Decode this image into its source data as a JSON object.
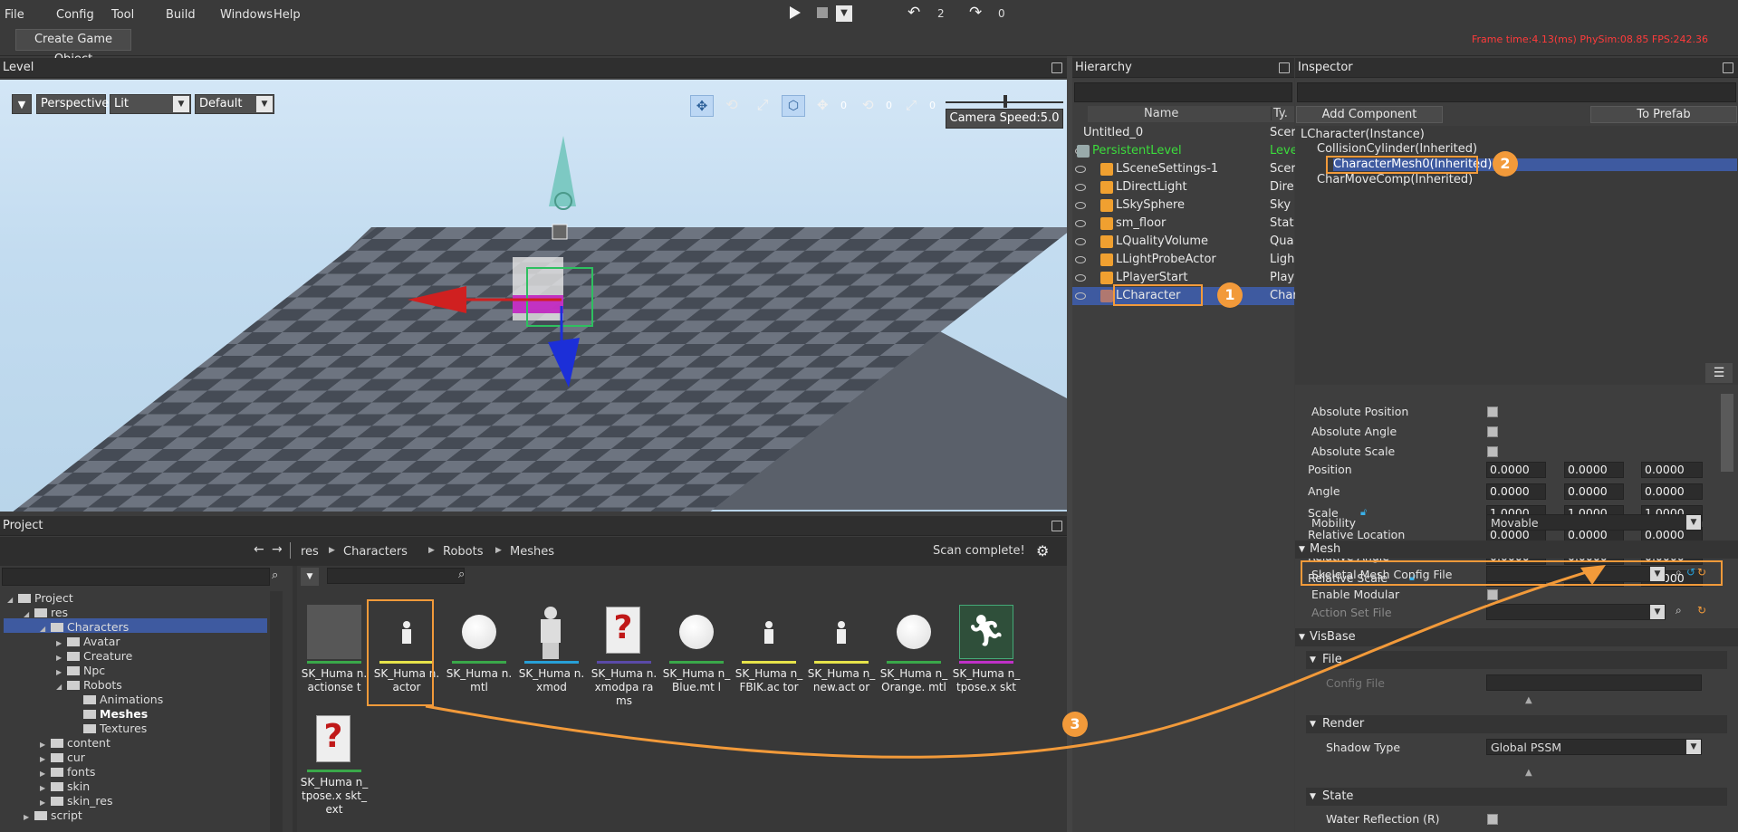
{
  "menu": {
    "items": [
      "File",
      "Config",
      "Tool",
      "Build",
      "Windows",
      "Help"
    ]
  },
  "playbar": {
    "undo_count": "2",
    "redo_count": "0"
  },
  "toolbar": {
    "create_game_object": "Create Game Object"
  },
  "stats": {
    "text": "Frame time:4.13(ms)  PhySim:08.85  FPS:242.36",
    "color": "#ff3b3b"
  },
  "level": {
    "title": "Level",
    "view_mode": "Perspective",
    "lighting": "Lit",
    "preset": "Default",
    "gizmo_counts": [
      "0",
      "0",
      "0"
    ],
    "camera_speed": "Camera Speed:5.0"
  },
  "hierarchy": {
    "title": "Hierarchy",
    "col_name": "Name",
    "col_type": "Ty.",
    "rows": [
      {
        "name": "Untitled_0",
        "type": "Scer"
      },
      {
        "name": "PersistentLevel",
        "type": "Leve"
      },
      {
        "name": "LSceneSettings-1",
        "type": "Scer"
      },
      {
        "name": "LDirectLight",
        "type": "Dire"
      },
      {
        "name": "LSkySphere",
        "type": "Sky"
      },
      {
        "name": "sm_floor",
        "type": "Stat"
      },
      {
        "name": "LQualityVolume",
        "type": "Qua"
      },
      {
        "name": "LLightProbeActor",
        "type": "Ligh"
      },
      {
        "name": "LPlayerStart",
        "type": "Play"
      },
      {
        "name": "LCharacter",
        "type": "Char"
      }
    ]
  },
  "inspector": {
    "title": "Inspector",
    "add_component": "Add Component",
    "to_prefab": "To Prefab",
    "tree": [
      "LCharacter(Instance)",
      "CollisionCylinder(Inherited)",
      "CharacterMesh0(Inherited)",
      "CharMoveComp(Inherited)"
    ],
    "checks": [
      "Absolute Position",
      "Absolute Angle",
      "Absolute Scale"
    ],
    "vectors": [
      {
        "label": "Position",
        "v": [
          "0.0000",
          "0.0000",
          "0.0000"
        ]
      },
      {
        "label": "Angle",
        "v": [
          "0.0000",
          "0.0000",
          "0.0000"
        ]
      },
      {
        "label": "Scale",
        "v": [
          "1.0000",
          "1.0000",
          "1.0000"
        ]
      },
      {
        "label": "Relative Location",
        "v": [
          "0.0000",
          "0.0000",
          "0.0000"
        ]
      },
      {
        "label": "Relative Angle",
        "v": [
          "0.0000",
          "0.0000",
          "0.0000"
        ]
      },
      {
        "label": "Relative Scale",
        "v": [
          "1.0000",
          "1.0000",
          "1.0000"
        ]
      }
    ],
    "mobility_label": "Mobility",
    "mobility_value": "Movable",
    "mesh_section": "Mesh",
    "skeletal_mesh_label": "Skeletal Mesh Config File",
    "enable_modular": "Enable Modular",
    "action_set_file": "Action Set File",
    "visbase_section": "VisBase",
    "file_section": "File",
    "config_file": "Config File",
    "render_section": "Render",
    "shadow_type_label": "Shadow Type",
    "shadow_type_value": "Global PSSM",
    "state_section": "State",
    "water_reflection": "Water Reflection (R)"
  },
  "project": {
    "title": "Project",
    "breadcrumb": [
      "res",
      "Characters",
      "Robots",
      "Meshes"
    ],
    "scan_status": "Scan complete!",
    "tree": [
      {
        "label": "Project",
        "indent": 0
      },
      {
        "label": "res",
        "indent": 1
      },
      {
        "label": "Characters",
        "indent": 2
      },
      {
        "label": "Avatar",
        "indent": 3
      },
      {
        "label": "Creature",
        "indent": 3
      },
      {
        "label": "Npc",
        "indent": 3
      },
      {
        "label": "Robots",
        "indent": 3
      },
      {
        "label": "Animations",
        "indent": 4
      },
      {
        "label": "Meshes",
        "indent": 4
      },
      {
        "label": "Textures",
        "indent": 4
      },
      {
        "label": "content",
        "indent": 2
      },
      {
        "label": "cur",
        "indent": 2
      },
      {
        "label": "fonts",
        "indent": 2
      },
      {
        "label": "skin",
        "indent": 2
      },
      {
        "label": "skin_res",
        "indent": 2
      },
      {
        "label": "script",
        "indent": 1
      }
    ],
    "assets": [
      {
        "name": "SK_Huma n.actionse t",
        "kind": "gray",
        "bar": "#3aa84a"
      },
      {
        "name": "SK_Huma n.actor",
        "kind": "figure",
        "bar": "#e6e34a"
      },
      {
        "name": "SK_Huma n.mtl",
        "kind": "sphere",
        "bar": "#3aa84a"
      },
      {
        "name": "SK_Huma n.xmod",
        "kind": "model",
        "bar": "#27a0d8"
      },
      {
        "name": "SK_Huma n.xmodpa rams",
        "kind": "doc",
        "bar": "#5a4aa8"
      },
      {
        "name": "SK_Huma n_Blue.mt l",
        "kind": "sphere",
        "bar": "#3aa84a"
      },
      {
        "name": "SK_Huma n_FBIK.ac tor",
        "kind": "figure",
        "bar": "#e6e34a"
      },
      {
        "name": "SK_Huma n_new.act or",
        "kind": "figure",
        "bar": "#e6e34a"
      },
      {
        "name": "SK_Huma n_Orange. mtl",
        "kind": "sphere",
        "bar": "#3aa84a"
      },
      {
        "name": "SK_Huma n_tpose.x skt",
        "kind": "run",
        "bar": "#c030c8"
      },
      {
        "name": "SK_Huma n_tpose.x skt_ext",
        "kind": "doc",
        "bar": "#3aa84a"
      }
    ]
  },
  "annotations": {
    "badge1": "1",
    "badge2": "2",
    "badge3": "3",
    "accent": "#f29a3a"
  }
}
